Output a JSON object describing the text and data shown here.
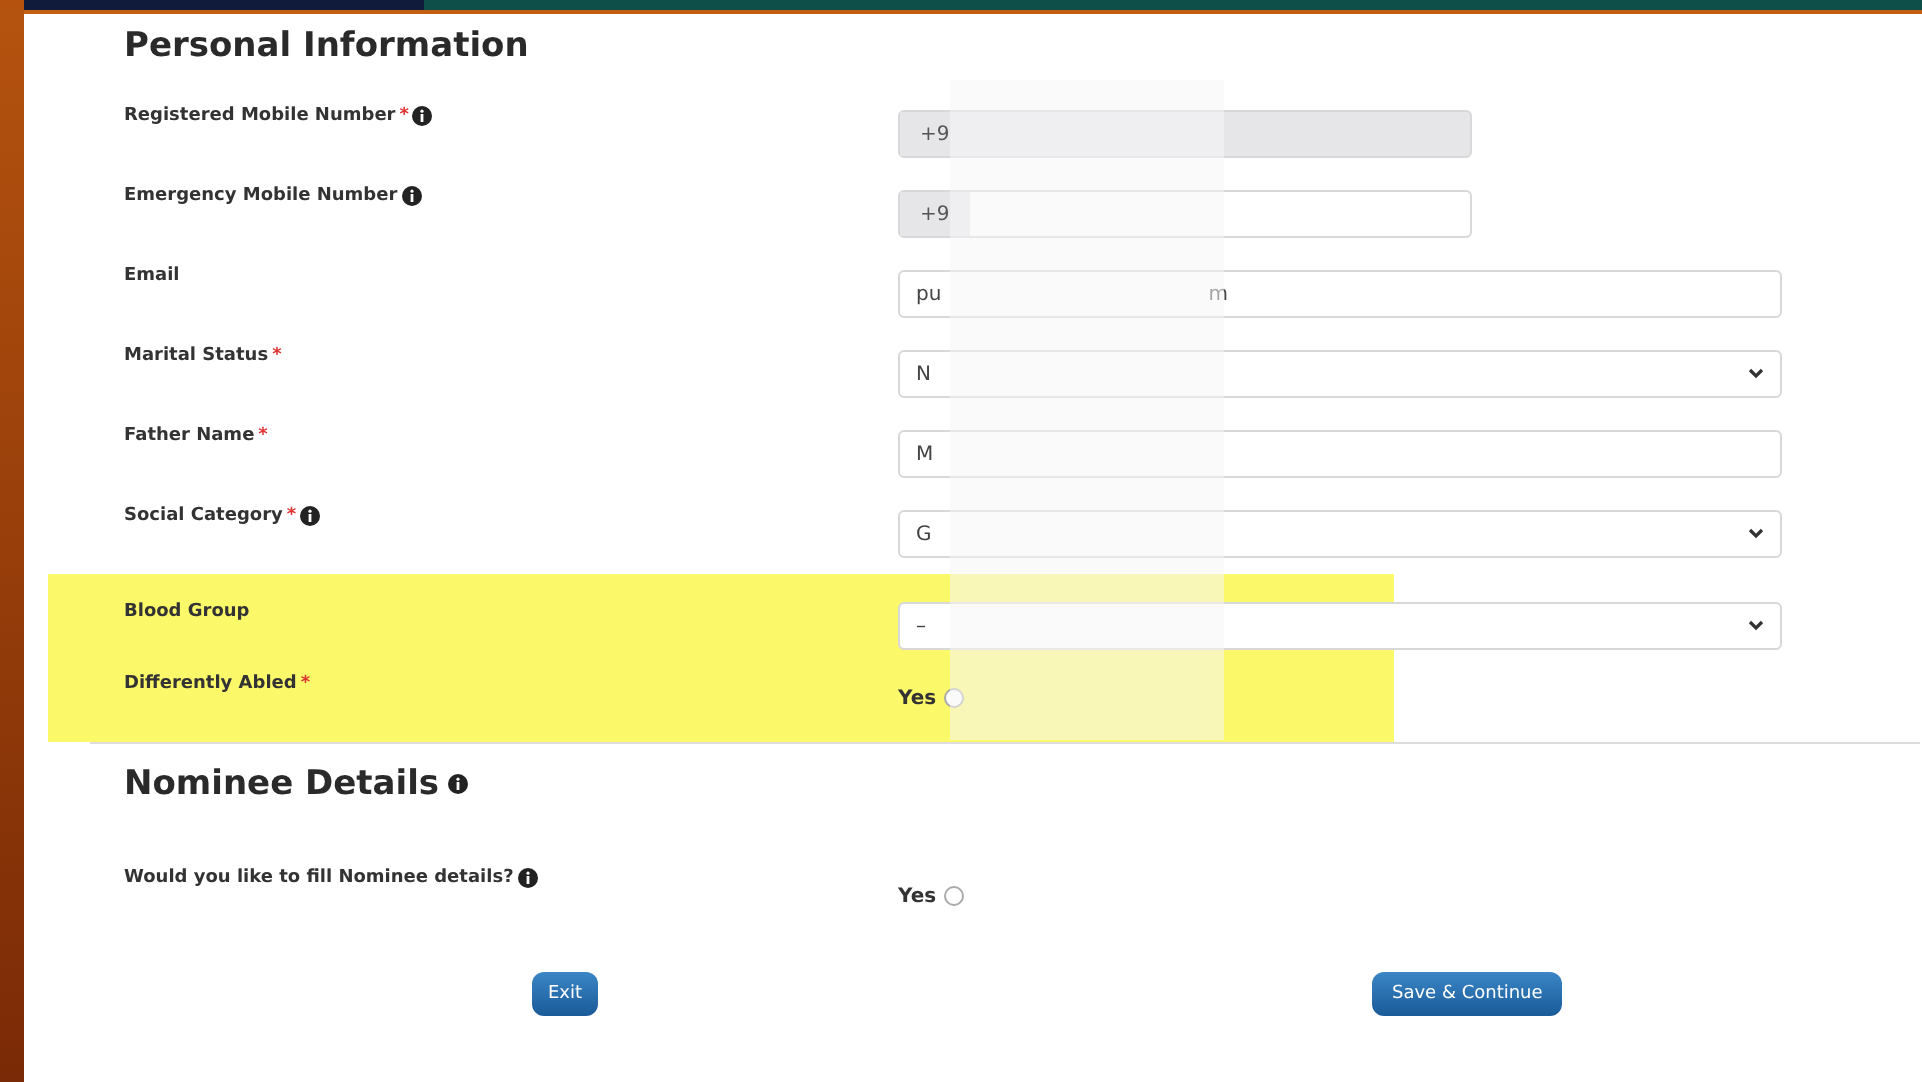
{
  "personal_information": {
    "title": "Personal Information",
    "fields": [
      {
        "kind": "phone",
        "label": "Registered Mobile Number",
        "required_mark": "*",
        "info": true,
        "prefix": "+9",
        "disabled": true
      },
      {
        "kind": "phone",
        "label": "Emergency Mobile Number",
        "info": true,
        "prefix": "+9",
        "disabled": false
      },
      {
        "kind": "text",
        "label": "Email",
        "info": false,
        "value": "pu",
        "value_end": "m"
      },
      {
        "kind": "select",
        "label": "Marital Status",
        "required_mark": "*",
        "info": false,
        "value": "N"
      },
      {
        "kind": "text",
        "label": "Father Name",
        "required_mark": "*",
        "info": false,
        "value": "M"
      },
      {
        "kind": "select",
        "label": "Social Category",
        "required_mark": "*",
        "info": true,
        "value": "G"
      }
    ],
    "highlighted_fields": [
      {
        "kind": "select",
        "label": "Blood Group",
        "info": false,
        "value": "–"
      },
      {
        "kind": "radio",
        "label": "Differently Abled",
        "required_mark": "*",
        "info": false,
        "options": [
          {
            "label": "Yes",
            "selected": false
          }
        ]
      }
    ]
  },
  "nominee_details": {
    "title": "Nominee Details",
    "info": true,
    "fields": [
      {
        "kind": "radio",
        "label": "Would you like to fill Nominee details?",
        "info": true,
        "options": [
          {
            "label": "Yes",
            "selected": false
          }
        ]
      }
    ]
  },
  "buttons": [
    {
      "kind": "secondary",
      "label": "Exit"
    },
    {
      "kind": "primary",
      "label": "Save & Continue"
    }
  ]
}
